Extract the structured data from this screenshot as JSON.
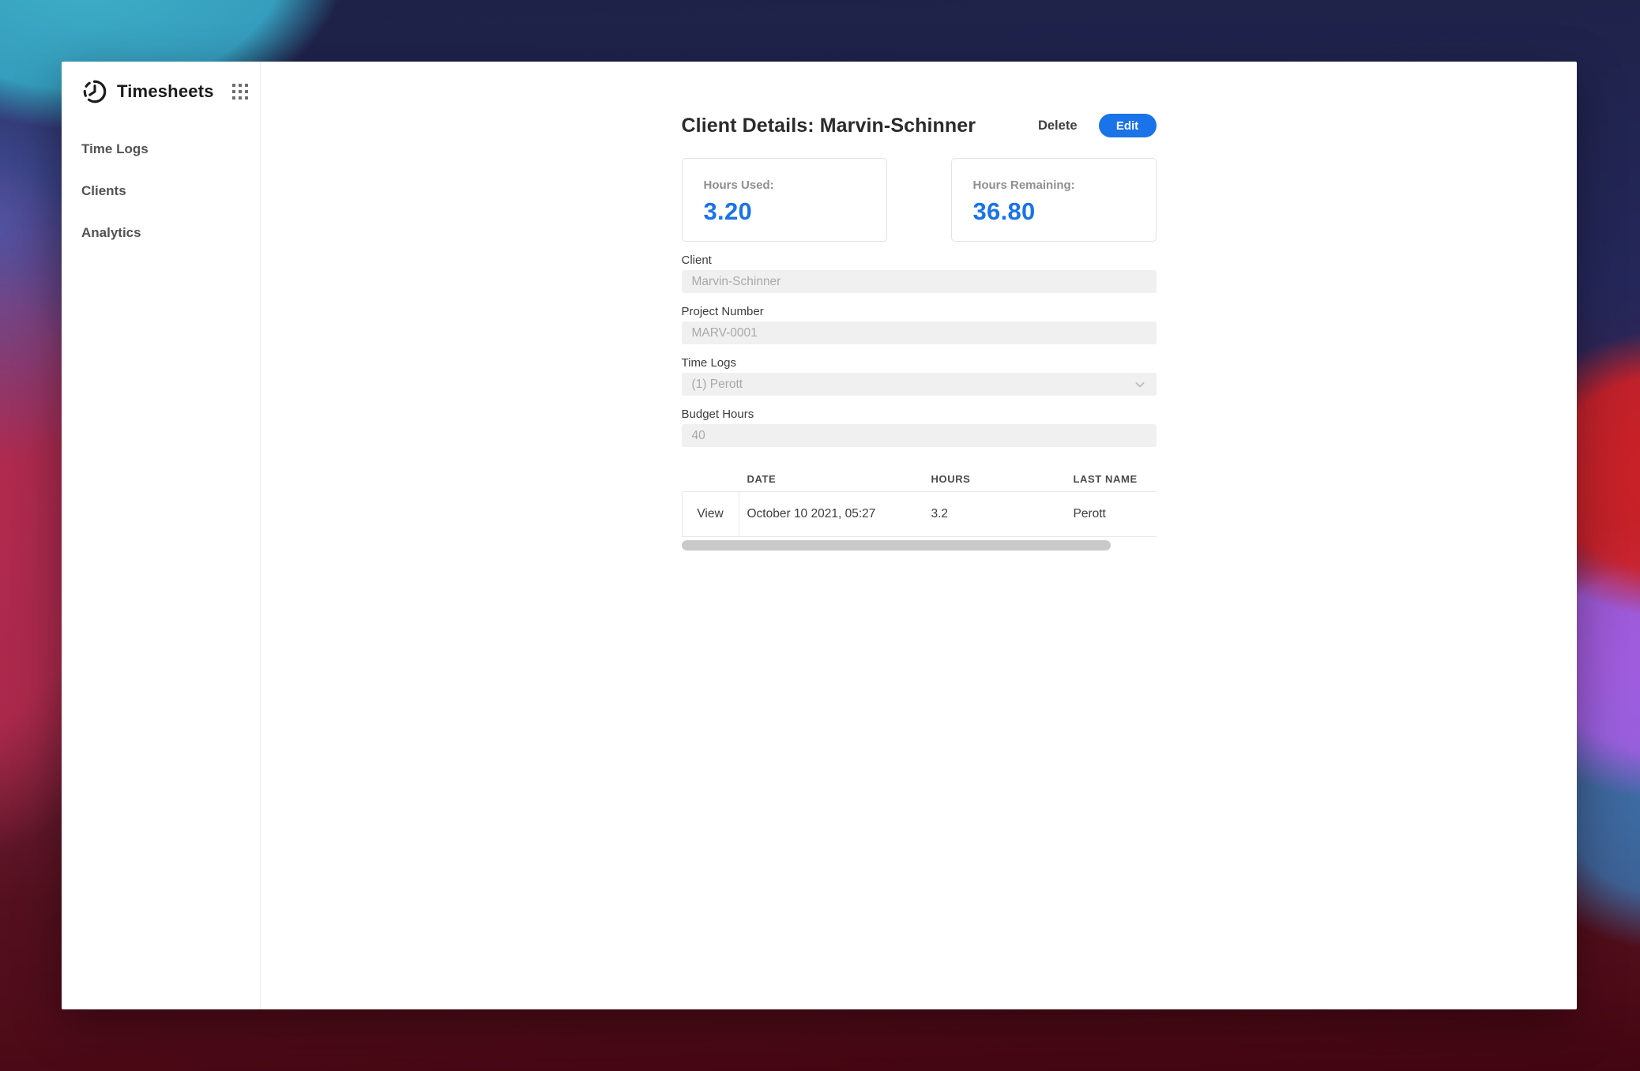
{
  "app": {
    "title": "Timesheets"
  },
  "sidebar": {
    "items": [
      {
        "label": "Time Logs"
      },
      {
        "label": "Clients"
      },
      {
        "label": "Analytics"
      }
    ]
  },
  "header": {
    "title": "Client Details: Marvin-Schinner",
    "delete_label": "Delete",
    "edit_label": "Edit"
  },
  "stats": [
    {
      "label": "Hours Used:",
      "value": "3.20"
    },
    {
      "label": "Hours Remaining:",
      "value": "36.80"
    }
  ],
  "form": {
    "fields": [
      {
        "label": "Client",
        "value": "Marvin-Schinner",
        "type": "text"
      },
      {
        "label": "Project Number",
        "value": "MARV-0001",
        "type": "text"
      },
      {
        "label": "Time Logs",
        "value": "(1) Perott",
        "type": "select"
      },
      {
        "label": "Budget Hours",
        "value": "40",
        "type": "text"
      }
    ]
  },
  "table": {
    "columns": [
      "DATE",
      "HOURS",
      "LAST NAME"
    ],
    "rows": [
      {
        "view_label": "View",
        "date": "October 10 2021, 05:27",
        "hours": "3.2",
        "last_name": "Perott"
      }
    ]
  },
  "icons": {
    "logo": "clock-icon",
    "apps": "grid-dots-icon",
    "select": "chevron-down-icon"
  },
  "colors": {
    "accent_blue": "#1a73e8",
    "input_background": "#f0f0f0",
    "muted_text": "#a9a9a9",
    "wallpaper_navy": "#1e2247",
    "wallpaper_teal": "#3aa6c2",
    "wallpaper_crimson": "#b62a4e",
    "wallpaper_maroon": "#4e0b18"
  }
}
